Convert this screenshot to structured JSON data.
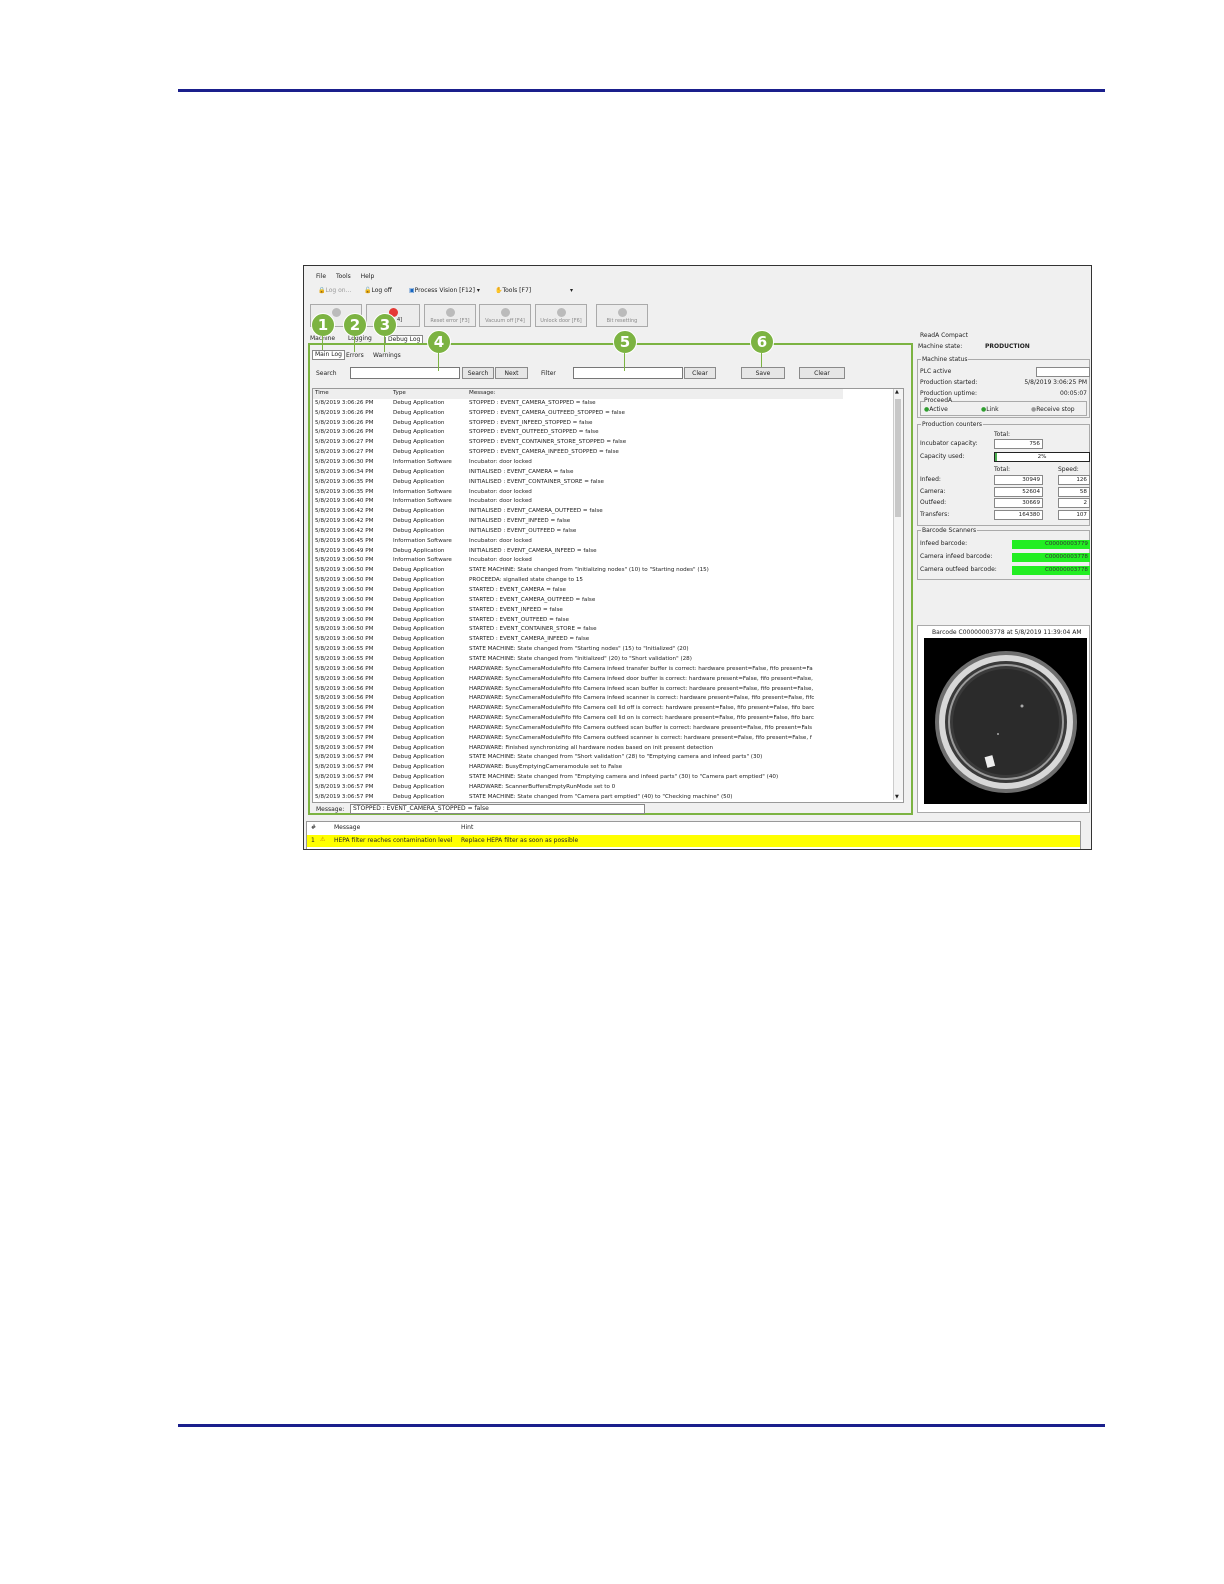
{
  "menu": [
    "File",
    "Tools",
    "Help"
  ],
  "toolbar": {
    "log_on": "Log on...",
    "log_off": "Log off",
    "process_vision": "Process Vision [F12]",
    "tools": "Tools [F7]"
  },
  "machine_buttons": {
    "partial": "4]",
    "reset_error": "Reset error [F3]",
    "vacuum_off": "Vacuum off [F4]",
    "unlock_door": "Unlock door [F6]",
    "bit_resetting": "Bit resetting"
  },
  "tabs": [
    "Machine",
    "Logging",
    "Debug Log"
  ],
  "subtabs": [
    "Main Log",
    "Errors",
    "Warnings"
  ],
  "search": {
    "label": "Search",
    "search_btn": "Search",
    "next_btn": "Next"
  },
  "filter": {
    "label": "Filter",
    "clear_btn": "Clear"
  },
  "actions": {
    "save": "Save",
    "clear": "Clear"
  },
  "callouts": [
    "1",
    "2",
    "3",
    "4",
    "5",
    "6"
  ],
  "log_headers": [
    "Time",
    "Type",
    "Message"
  ],
  "log_rows": [
    [
      "5/8/2019 3:06:26 PM",
      "Debug Application",
      "STOPPED : EVENT_CAMERA_STOPPED = false"
    ],
    [
      "5/8/2019 3:06:26 PM",
      "Debug Application",
      "STOPPED : EVENT_CAMERA_OUTFEED_STOPPED = false"
    ],
    [
      "5/8/2019 3:06:26 PM",
      "Debug Application",
      "STOPPED : EVENT_INFEED_STOPPED = false"
    ],
    [
      "5/8/2019 3:06:26 PM",
      "Debug Application",
      "STOPPED : EVENT_OUTFEED_STOPPED = false"
    ],
    [
      "5/8/2019 3:06:27 PM",
      "Debug Application",
      "STOPPED : EVENT_CONTAINER_STORE_STOPPED = false"
    ],
    [
      "5/8/2019 3:06:27 PM",
      "Debug Application",
      "STOPPED : EVENT_CAMERA_INFEED_STOPPED = false"
    ],
    [
      "5/8/2019 3:06:30 PM",
      "Information Software",
      "Incubator: door locked"
    ],
    [
      "5/8/2019 3:06:34 PM",
      "Debug Application",
      "INITIALISED : EVENT_CAMERA = false"
    ],
    [
      "5/8/2019 3:06:35 PM",
      "Debug Application",
      "INITIALISED : EVENT_CONTAINER_STORE = false"
    ],
    [
      "5/8/2019 3:06:35 PM",
      "Information Software",
      "Incubator: door locked"
    ],
    [
      "5/8/2019 3:06:40 PM",
      "Information Software",
      "Incubator: door locked"
    ],
    [
      "5/8/2019 3:06:42 PM",
      "Debug Application",
      "INITIALISED : EVENT_CAMERA_OUTFEED = false"
    ],
    [
      "5/8/2019 3:06:42 PM",
      "Debug Application",
      "INITIALISED : EVENT_INFEED = false"
    ],
    [
      "5/8/2019 3:06:42 PM",
      "Debug Application",
      "INITIALISED : EVENT_OUTFEED = false"
    ],
    [
      "5/8/2019 3:06:45 PM",
      "Information Software",
      "Incubator: door locked"
    ],
    [
      "5/8/2019 3:06:49 PM",
      "Debug Application",
      "INITIALISED : EVENT_CAMERA_INFEED = false"
    ],
    [
      "5/8/2019 3:06:50 PM",
      "Information Software",
      "Incubator: door locked"
    ],
    [
      "5/8/2019 3:06:50 PM",
      "Debug Application",
      "STATE MACHINE: State changed from \"Initializing nodes\" (10) to \"Starting nodes\" (15)"
    ],
    [
      "5/8/2019 3:06:50 PM",
      "Debug Application",
      "PROCEEDA: signalled state change to 15"
    ],
    [
      "5/8/2019 3:06:50 PM",
      "Debug Application",
      "STARTED : EVENT_CAMERA = false"
    ],
    [
      "5/8/2019 3:06:50 PM",
      "Debug Application",
      "STARTED : EVENT_CAMERA_OUTFEED = false"
    ],
    [
      "5/8/2019 3:06:50 PM",
      "Debug Application",
      "STARTED : EVENT_INFEED = false"
    ],
    [
      "5/8/2019 3:06:50 PM",
      "Debug Application",
      "STARTED : EVENT_OUTFEED = false"
    ],
    [
      "5/8/2019 3:06:50 PM",
      "Debug Application",
      "STARTED : EVENT_CONTAINER_STORE = false"
    ],
    [
      "5/8/2019 3:06:50 PM",
      "Debug Application",
      "STARTED : EVENT_CAMERA_INFEED = false"
    ],
    [
      "5/8/2019 3:06:55 PM",
      "Debug Application",
      "STATE MACHINE: State changed from \"Starting nodes\" (15) to \"Initialized\" (20)"
    ],
    [
      "5/8/2019 3:06:55 PM",
      "Debug Application",
      "STATE MACHINE: State changed from \"Initialized\" (20) to \"Short validation\" (28)"
    ],
    [
      "5/8/2019 3:06:56 PM",
      "Debug Application",
      "HARDWARE: SyncCameraModuleFifo fifo Camera infeed transfer buffer is correct: hardware present=False, fifo present=Fa"
    ],
    [
      "5/8/2019 3:06:56 PM",
      "Debug Application",
      "HARDWARE: SyncCameraModuleFifo fifo Camera infeed door buffer is correct: hardware present=False, fifo present=False,"
    ],
    [
      "5/8/2019 3:06:56 PM",
      "Debug Application",
      "HARDWARE: SyncCameraModuleFifo fifo Camera infeed scan buffer is correct: hardware present=False, fifo present=False,"
    ],
    [
      "5/8/2019 3:06:56 PM",
      "Debug Application",
      "HARDWARE: SyncCameraModuleFifo fifo Camera infeed scanner is correct: hardware present=False, fifo present=False, fifc"
    ],
    [
      "5/8/2019 3:06:56 PM",
      "Debug Application",
      "HARDWARE: SyncCameraModuleFifo fifo Camera cell lid off is correct: hardware present=False, fifo present=False, fifo barc"
    ],
    [
      "5/8/2019 3:06:57 PM",
      "Debug Application",
      "HARDWARE: SyncCameraModuleFifo fifo Camera cell lid on is correct: hardware present=False, fifo present=False, fifo barc"
    ],
    [
      "5/8/2019 3:06:57 PM",
      "Debug Application",
      "HARDWARE: SyncCameraModuleFifo fifo Camera outfeed scan buffer is correct: hardware present=False, fifo present=Fals"
    ],
    [
      "5/8/2019 3:06:57 PM",
      "Debug Application",
      "HARDWARE: SyncCameraModuleFifo fifo Camera outfeed scanner is correct: hardware present=False, fifo present=False, f"
    ],
    [
      "5/8/2019 3:06:57 PM",
      "Debug Application",
      "HARDWARE: Finished synchronizing all hardware nodes based on init present detection"
    ],
    [
      "5/8/2019 3:06:57 PM",
      "Debug Application",
      "STATE MACHINE: State changed from \"Short validation\" (28) to \"Emptying camera and infeed parts\" (30)"
    ],
    [
      "5/8/2019 3:06:57 PM",
      "Debug Application",
      "HARDWARE: BusyEmptyingCameramodule set to False"
    ],
    [
      "5/8/2019 3:06:57 PM",
      "Debug Application",
      "STATE MACHINE: State changed from \"Emptying camera and infeed parts\" (30) to \"Camera part emptied\" (40)"
    ],
    [
      "5/8/2019 3:06:57 PM",
      "Debug Application",
      "HARDWARE: ScannerBuffersEmptyRunMode set to 0"
    ],
    [
      "5/8/2019 3:06:57 PM",
      "Debug Application",
      "STATE MACHINE: State changed from \"Camera part emptied\" (40) to \"Checking machine\" (50)"
    ]
  ],
  "message_bar": {
    "label": "Message:",
    "value": "STOPPED : EVENT_CAMERA_STOPPED = false"
  },
  "alarm": {
    "col_hash": "#",
    "col_message": "Message",
    "col_hint": "Hint",
    "index": "1",
    "message": "HEPA filter reaches contamination level",
    "hint": "Replace HEPA filter as soon as possible"
  },
  "right": {
    "group_title": "ReadA Compact",
    "machine_state_label": "Machine state:",
    "machine_state": "PRODUCTION",
    "status_title": "Machine status",
    "plc_active": "PLC active",
    "production_started_label": "Production started:",
    "production_started": "5/8/2019 3:06:25 PM",
    "production_uptime_label": "Production uptime:",
    "production_uptime": "00:05:07",
    "proceeda_title": "ProceedA",
    "proceeda_items": [
      "Active",
      "Link",
      "Receive stop"
    ],
    "counters_title": "Production counters",
    "total_label": "Total:",
    "speed_label": "Speed:",
    "incubator_capacity_label": "Incubator capacity:",
    "incubator_capacity": "756",
    "capacity_used_label": "Capacity used:",
    "capacity_used": "2%",
    "counters": [
      {
        "label": "Infeed:",
        "total": "30949",
        "speed": "126"
      },
      {
        "label": "Camera:",
        "total": "52604",
        "speed": "58"
      },
      {
        "label": "Outfeed:",
        "total": "30669",
        "speed": "2"
      },
      {
        "label": "Transfers:",
        "total": "164380",
        "speed": "107"
      }
    ],
    "barcode_title": "Barcode Scanners",
    "barcodes": [
      {
        "label": "Infeed barcode:",
        "value": "C00000003779"
      },
      {
        "label": "Camera infeed barcode:",
        "value": "C00000003778"
      },
      {
        "label": "Camera outfeed barcode:",
        "value": "C00000003778"
      }
    ],
    "image_caption": "Barcode C00000003778 at 5/8/2019 11:39:04 AM"
  },
  "colors": {
    "accent_green": "#7cb342",
    "rule_blue": "#1a1f8c",
    "alarm_yellow": "#ffff00",
    "barcode_green": "#22ee22"
  }
}
